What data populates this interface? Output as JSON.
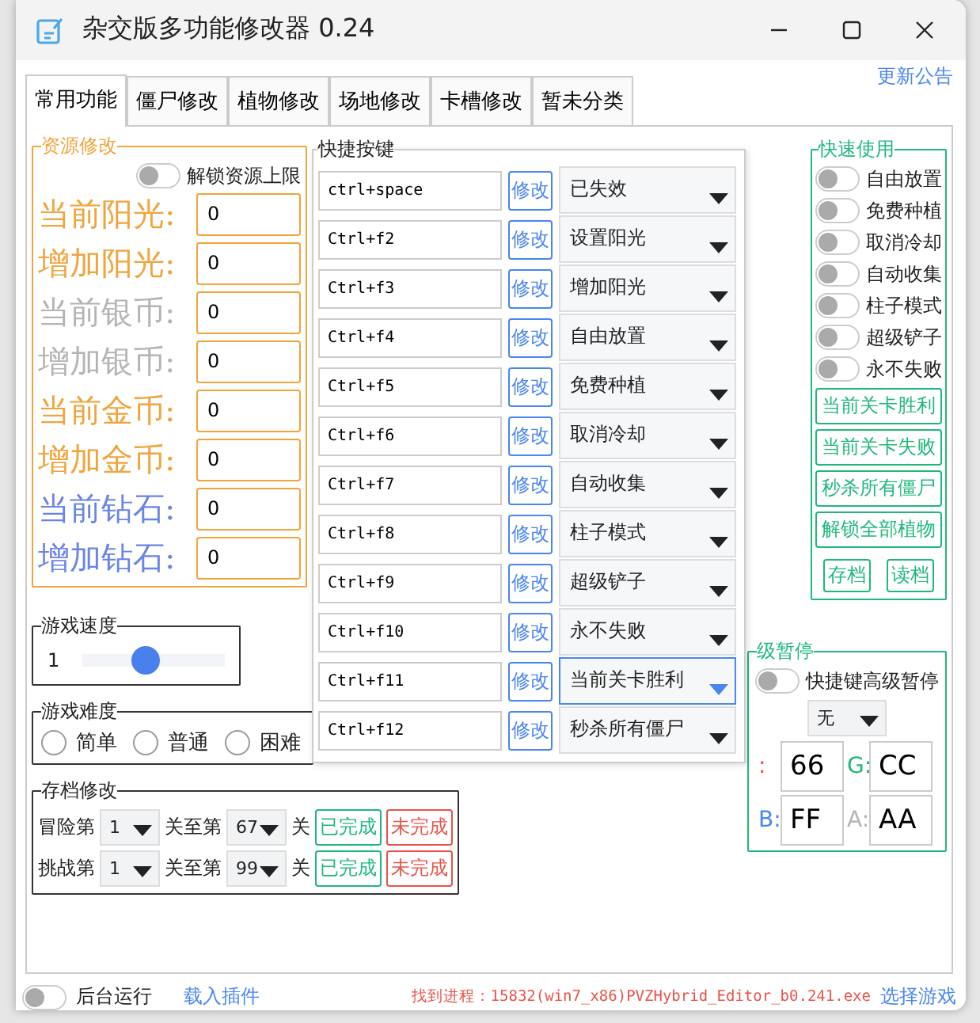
{
  "window": {
    "title": "杂交版多功能修改器  0.24"
  },
  "update_link": "更新公告",
  "tabs": [
    {
      "label": "常用功能",
      "selected": true
    },
    {
      "label": "僵尸修改",
      "selected": false
    },
    {
      "label": "植物修改",
      "selected": false
    },
    {
      "label": "场地修改",
      "selected": false
    },
    {
      "label": "卡槽修改",
      "selected": false
    },
    {
      "label": "暂未分类",
      "selected": false
    }
  ],
  "resources": {
    "title": "资源修改",
    "unlock": {
      "label": "解锁资源上限",
      "on": false
    },
    "rows": [
      {
        "label": "当前阳光:",
        "value": "0",
        "color": "#f0a43c"
      },
      {
        "label": "增加阳光:",
        "value": "0",
        "color": "#f0a43c"
      },
      {
        "label": "当前银币:",
        "value": "0",
        "color": "#b4b4b4"
      },
      {
        "label": "增加银币:",
        "value": "0",
        "color": "#b4b4b4"
      },
      {
        "label": "当前金币:",
        "value": "0",
        "color": "#f0a43c"
      },
      {
        "label": "增加金币:",
        "value": "0",
        "color": "#f0a43c"
      },
      {
        "label": "当前钻石:",
        "value": "0",
        "color": "#6a85e6"
      },
      {
        "label": "增加钻石:",
        "value": "0",
        "color": "#6a85e6"
      }
    ]
  },
  "speed": {
    "title": "游戏速度",
    "value": "1",
    "level": 0.45
  },
  "difficulty": {
    "title": "游戏难度",
    "options": [
      {
        "label": "简单",
        "selected": false
      },
      {
        "label": "普通",
        "selected": false
      },
      {
        "label": "困难",
        "selected": false
      }
    ]
  },
  "save_edit": {
    "title": "存档修改",
    "rows": [
      {
        "mode": "冒险第",
        "from": "1",
        "to_label": "关至第",
        "to": "67",
        "unit": "关",
        "done": "已完成",
        "undone": "未完成"
      },
      {
        "mode": "挑战第",
        "from": "1",
        "to_label": "关至第",
        "to": "99",
        "unit": "关",
        "done": "已完成",
        "undone": "未完成"
      }
    ]
  },
  "hotkeys": {
    "title": "快捷按键",
    "rows": [
      {
        "key": "ctrl+space",
        "button": "修改",
        "action": "已失效",
        "selected": false
      },
      {
        "key": "Ctrl+f2",
        "button": "修改",
        "action": "设置阳光",
        "selected": false
      },
      {
        "key": "Ctrl+f3",
        "button": "修改",
        "action": "增加阳光",
        "selected": false
      },
      {
        "key": "Ctrl+f4",
        "button": "修改",
        "action": "自由放置",
        "selected": false
      },
      {
        "key": "Ctrl+f5",
        "button": "修改",
        "action": "免费种植",
        "selected": false
      },
      {
        "key": "Ctrl+f6",
        "button": "修改",
        "action": "取消冷却",
        "selected": false
      },
      {
        "key": "Ctrl+f7",
        "button": "修改",
        "action": "自动收集",
        "selected": false
      },
      {
        "key": "Ctrl+f8",
        "button": "修改",
        "action": "柱子模式",
        "selected": false
      },
      {
        "key": "Ctrl+f9",
        "button": "修改",
        "action": "超级铲子",
        "selected": false
      },
      {
        "key": "Ctrl+f10",
        "button": "修改",
        "action": "永不失败",
        "selected": false
      },
      {
        "key": "Ctrl+f11",
        "button": "修改",
        "action": "当前关卡胜利",
        "selected": true
      },
      {
        "key": "Ctrl+f12",
        "button": "修改",
        "action": "秒杀所有僵尸",
        "selected": false
      }
    ]
  },
  "quick_use": {
    "title": "快速使用",
    "toggles": [
      {
        "label": "自由放置",
        "on": false
      },
      {
        "label": "免费种植",
        "on": false
      },
      {
        "label": "取消冷却",
        "on": false
      },
      {
        "label": "自动收集",
        "on": false
      },
      {
        "label": "柱子模式",
        "on": false
      },
      {
        "label": "超级铲子",
        "on": false
      },
      {
        "label": "永不失败",
        "on": false
      }
    ],
    "buttons": [
      "当前关卡胜利",
      "当前关卡失败",
      "秒杀所有僵尸",
      "解锁全部植物"
    ],
    "small_buttons": [
      "存档",
      "读档"
    ]
  },
  "advanced_pause": {
    "title": "级暂停",
    "toggle": {
      "label": "快捷键高级暂停",
      "on": false
    },
    "select": "无",
    "channels": [
      {
        "label": ":",
        "value": "66",
        "color": "#e8524a"
      },
      {
        "label": "G:",
        "value": "CC",
        "color": "#1fb87a"
      },
      {
        "label": "B:",
        "value": "FF",
        "color": "#4a86f0"
      },
      {
        "label": "A:",
        "value": "AA",
        "color": "#b4b4b4"
      }
    ]
  },
  "status_bar": {
    "background": {
      "label": "后台运行",
      "on": false
    },
    "plugin_link": "载入插件",
    "process": "找到进程：15832(win7_x86)PVZHybrid_Editor_b0.241.exe",
    "select_link": "选择游戏"
  }
}
